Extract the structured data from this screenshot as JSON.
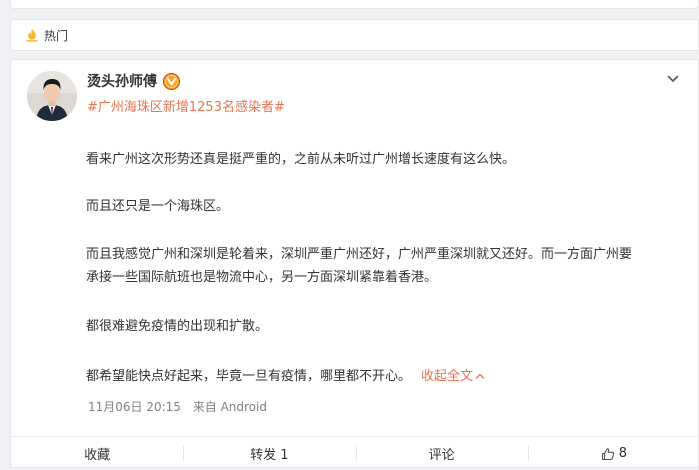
{
  "feed": {
    "section_label": "热门"
  },
  "post": {
    "author_name": "烫头孙师傅",
    "topic": "#广州海珠区新增1253名感染者#",
    "paragraphs": [
      "看来广州这次形势还真是挺严重的，之前从未听过广州增长速度有这么快。",
      "而且还只是一个海珠区。",
      "而且我感觉广州和深圳是轮着来，深圳严重广州还好，广州严重深圳就又还好。而一方面广州要",
      "承接一些国际航班也是物流中心，另一方面深圳紧靠着香港。",
      "都很难避免疫情的出现和扩散。",
      "都希望能快点好起来，毕竟一旦有疫情，哪里都不开心。"
    ],
    "collapse_label": "收起全文",
    "timestamp": "11月06日 20:15",
    "source": "来自 Android"
  },
  "actions": {
    "favorite": "收藏",
    "repost": "转发 1",
    "comment": "评论",
    "like_count": "8"
  },
  "colors": {
    "accent": "#eb7350",
    "verified_badge": "#f5a623",
    "background": "#f0f1f4"
  },
  "icons": [
    "hot-fire-icon",
    "verified-icon",
    "chevron-down-icon",
    "thumbs-up-icon"
  ]
}
